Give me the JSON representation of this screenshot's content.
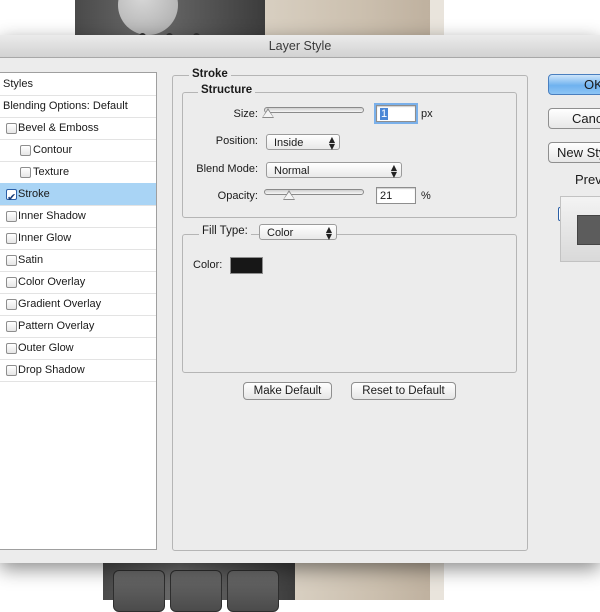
{
  "window": {
    "title": "Layer Style"
  },
  "styles_panel": {
    "header": "Styles",
    "blending": "Blending Options: Default",
    "items": [
      {
        "label": "Bevel & Emboss",
        "checked": false
      },
      {
        "label": "Contour",
        "checked": false
      },
      {
        "label": "Texture",
        "checked": false
      },
      {
        "label": "Stroke",
        "checked": true,
        "selected": true
      },
      {
        "label": "Inner Shadow",
        "checked": false
      },
      {
        "label": "Inner Glow",
        "checked": false
      },
      {
        "label": "Satin",
        "checked": false
      },
      {
        "label": "Color Overlay",
        "checked": false
      },
      {
        "label": "Gradient Overlay",
        "checked": false
      },
      {
        "label": "Pattern Overlay",
        "checked": false
      },
      {
        "label": "Outer Glow",
        "checked": false
      },
      {
        "label": "Drop Shadow",
        "checked": false
      }
    ]
  },
  "stroke": {
    "title": "Stroke",
    "structure": {
      "title": "Structure",
      "size_label": "Size:",
      "size_value": "1",
      "size_unit": "px",
      "position_label": "Position:",
      "position_value": "Inside",
      "blend_label": "Blend Mode:",
      "blend_value": "Normal",
      "opacity_label": "Opacity:",
      "opacity_value": "21",
      "opacity_unit": "%"
    },
    "fill": {
      "type_label": "Fill Type:",
      "type_value": "Color",
      "color_label": "Color:",
      "color_hex": "#171717"
    },
    "make_default": "Make Default",
    "reset_default": "Reset to Default"
  },
  "right_panel": {
    "ok": "OK",
    "cancel": "Cancel",
    "new_style": "New Style...",
    "preview": "Preview"
  }
}
